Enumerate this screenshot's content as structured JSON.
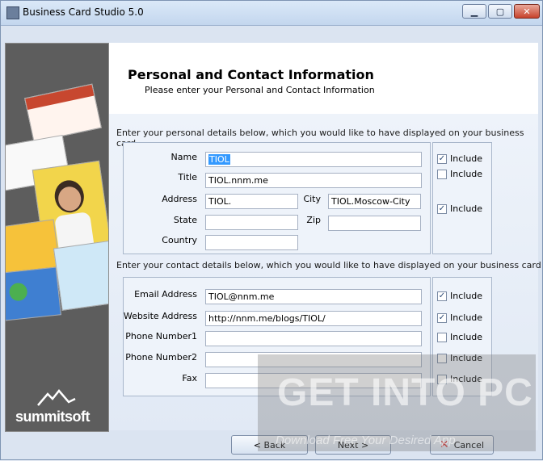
{
  "window": {
    "title": "Business Card Studio 5.0"
  },
  "header": {
    "title": "Personal and Contact Information",
    "subtitle": "Please enter your Personal and Contact Information"
  },
  "sidebar": {
    "logo_text": "summitsoft"
  },
  "personal": {
    "intro": "Enter your personal details below, which you would like to have displayed on your business card",
    "name_label": "Name",
    "name_value": "TIOL",
    "title_label": "Title",
    "title_value": "TIOL.nnm.me",
    "address_label": "Address",
    "address_value": "TIOL.",
    "city_label": "City",
    "city_value": "TIOL.Moscow-City",
    "state_label": "State",
    "state_value": "",
    "zip_label": "Zip",
    "zip_value": "",
    "country_label": "Country",
    "country_value": "",
    "include_label": "Include",
    "include_name": true,
    "include_title": false,
    "include_address": true
  },
  "contact": {
    "intro": "Enter your contact details below, which you would like to have displayed on your business card",
    "email_label": "Email Address",
    "email_value": "TIOL@nnm.me",
    "website_label": "Website Address",
    "website_value": "http://nnm.me/blogs/TIOL/",
    "phone1_label": "Phone Number1",
    "phone1_value": "",
    "phone2_label": "Phone Number2",
    "phone2_value": "",
    "fax_label": "Fax",
    "fax_value": "",
    "include_label": "Include",
    "include_email": true,
    "include_website": true,
    "include_phone1": false,
    "include_phone2": false,
    "include_fax": false
  },
  "buttons": {
    "back": "< Back",
    "next": "Next >",
    "cancel": "Cancel"
  },
  "watermark": {
    "main": "GET INTO PC",
    "sub": "Download Free Your Desired App"
  },
  "colors": {
    "accent": "#3399ff",
    "cancel_icon": "#d32f2f"
  }
}
